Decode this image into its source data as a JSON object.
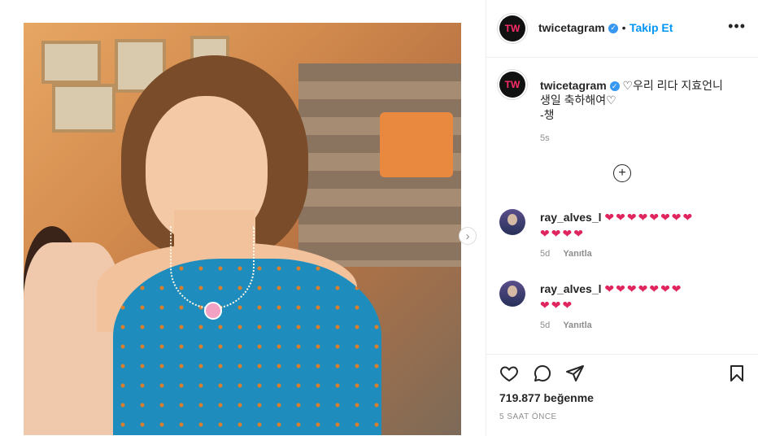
{
  "post": {
    "username": "twicetagram",
    "follow_label": "Takip Et",
    "caption_lines": [
      "♡우리 리다 지효언니",
      "생일 축하해여♡",
      "-챙"
    ],
    "caption_time": "5s",
    "likes": "719.877 beğenme",
    "time_ago": "5 SAAT ÖNCE"
  },
  "comments": [
    {
      "username": "ray_alves_l",
      "hearts_line1": "❤❤❤❤❤❤❤❤",
      "hearts_line2": "❤❤❤❤",
      "time": "5d",
      "reply_label": "Yanıtla"
    },
    {
      "username": "ray_alves_l",
      "hearts_line1": "❤❤❤❤❤❤❤",
      "hearts_line2": "❤❤❤",
      "time": "5d",
      "reply_label": "Yanıtla"
    }
  ],
  "icons": {
    "avatar_logo": "TW",
    "more": "•••",
    "next": "›",
    "load_more": "+",
    "verified": "✓"
  },
  "colors": {
    "accent_blue": "#0095f6",
    "verified_blue": "#3897f0",
    "heart_red": "#e0245e",
    "border_gray": "#efefef",
    "muted_text": "#8e8e8e"
  }
}
